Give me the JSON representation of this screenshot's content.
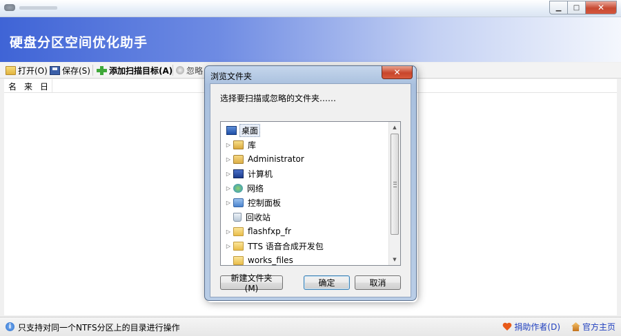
{
  "app": {
    "title": "硬盘分区空间优化助手",
    "window_controls": {
      "minimize": "▁",
      "maximize": "□",
      "close": "✕"
    }
  },
  "toolbar": {
    "open": "打开(O)",
    "save": "保存(S)",
    "add_target": "添加扫描目标(A)",
    "ignore": "忽略"
  },
  "list": {
    "columns": [
      "名",
      "来",
      "日"
    ]
  },
  "status": {
    "info_icon": "i",
    "message": "只支持对同一个NTFS分区上的目录进行操作",
    "donate": "捐助作者(D)",
    "homepage": "官方主页"
  },
  "dialog": {
    "title": "浏览文件夹",
    "close": "✕",
    "instruction": "选择要扫描或忽略的文件夹……",
    "tree": [
      {
        "label": "桌面",
        "icon": "desktop-icon",
        "expandable": false,
        "selected": true,
        "level": 0
      },
      {
        "label": "库",
        "icon": "library-icon",
        "expandable": true,
        "selected": false,
        "level": 1
      },
      {
        "label": "Administrator",
        "icon": "user-folder-icon",
        "expandable": true,
        "selected": false,
        "level": 1
      },
      {
        "label": "计算机",
        "icon": "computer-icon",
        "expandable": true,
        "selected": false,
        "level": 1
      },
      {
        "label": "网络",
        "icon": "network-icon",
        "expandable": true,
        "selected": false,
        "level": 1
      },
      {
        "label": "控制面板",
        "icon": "control-panel-icon",
        "expandable": true,
        "selected": false,
        "level": 1
      },
      {
        "label": "回收站",
        "icon": "recycle-bin-icon",
        "expandable": false,
        "selected": false,
        "level": 1
      },
      {
        "label": "flashfxp_fr",
        "icon": "folder-icon",
        "expandable": true,
        "selected": false,
        "level": 1
      },
      {
        "label": "TTS 语音合成开发包",
        "icon": "folder-icon",
        "expandable": true,
        "selected": false,
        "level": 1
      },
      {
        "label": "works_files",
        "icon": "folder-icon",
        "expandable": false,
        "selected": false,
        "level": 1
      }
    ],
    "buttons": {
      "new_folder": "新建文件夹(M)",
      "ok": "确定",
      "cancel": "取消"
    }
  }
}
